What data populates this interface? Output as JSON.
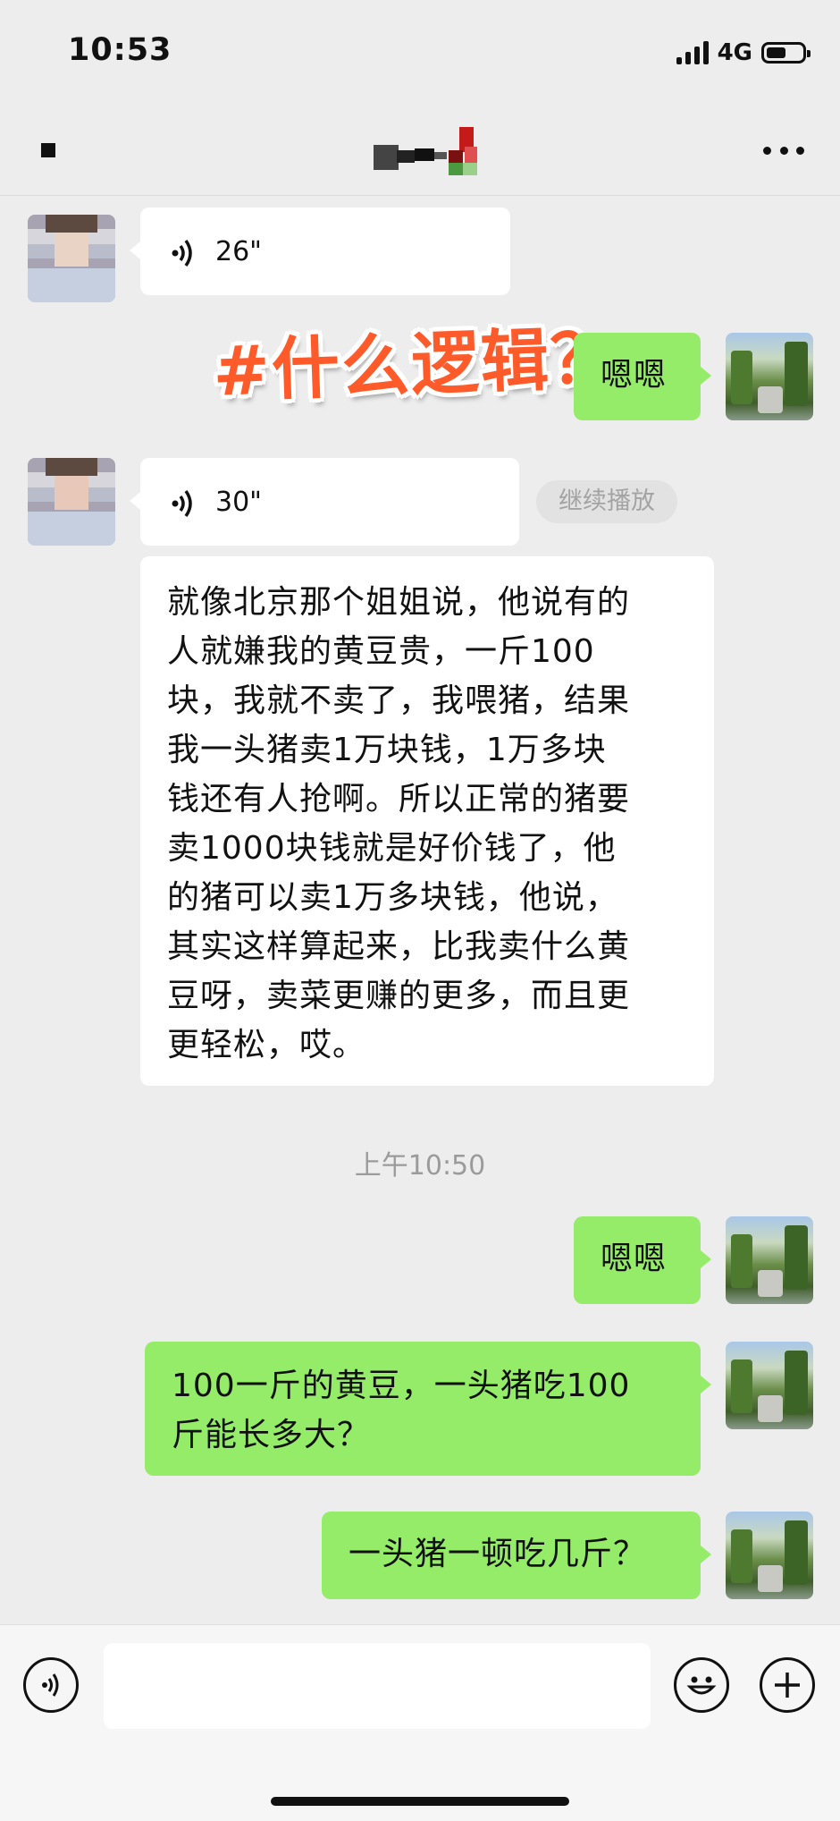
{
  "status_bar": {
    "time": "10:53",
    "network": "4G",
    "battery_level": 0.55
  },
  "overlay_title": "#什么逻辑？",
  "messages": [
    {
      "type": "voice",
      "duration": "26\""
    },
    {
      "type": "text",
      "text": "嗯嗯"
    },
    {
      "type": "voice",
      "duration": "30\"",
      "continue_label": "继续播放"
    },
    {
      "type": "text",
      "lines": [
        "就像北京那个姐姐说，他说有的",
        "人就嫌我的黄豆贵，一斤100",
        "块，我就不卖了，我喂猪，结果",
        "我一头猪卖1万块钱，1万多块",
        "钱还有人抢啊。所以正常的猪要",
        "卖1000块钱就是好价钱了，他",
        "的猪可以卖1万多块钱，他说，",
        "其实这样算起来，比我卖什么黄",
        "豆呀，卖菜更赚的更多，而且更",
        "更轻松，哎。"
      ]
    },
    {
      "type": "timestamp",
      "text": "上午10:50"
    },
    {
      "type": "text",
      "text": "嗯嗯"
    },
    {
      "type": "text",
      "lines": [
        "100一斤的黄豆，一头猪吃100",
        "斤能长多大？"
      ]
    },
    {
      "type": "text",
      "text": "一头猪一顿吃几斤？"
    }
  ],
  "icons": {
    "more": "more-icon",
    "voice": "voice-icon",
    "emoji": "emoji-icon",
    "add": "plus-icon"
  },
  "colors": {
    "green_bubble": "#95ec69",
    "overlay_text": "#ff5a29"
  }
}
